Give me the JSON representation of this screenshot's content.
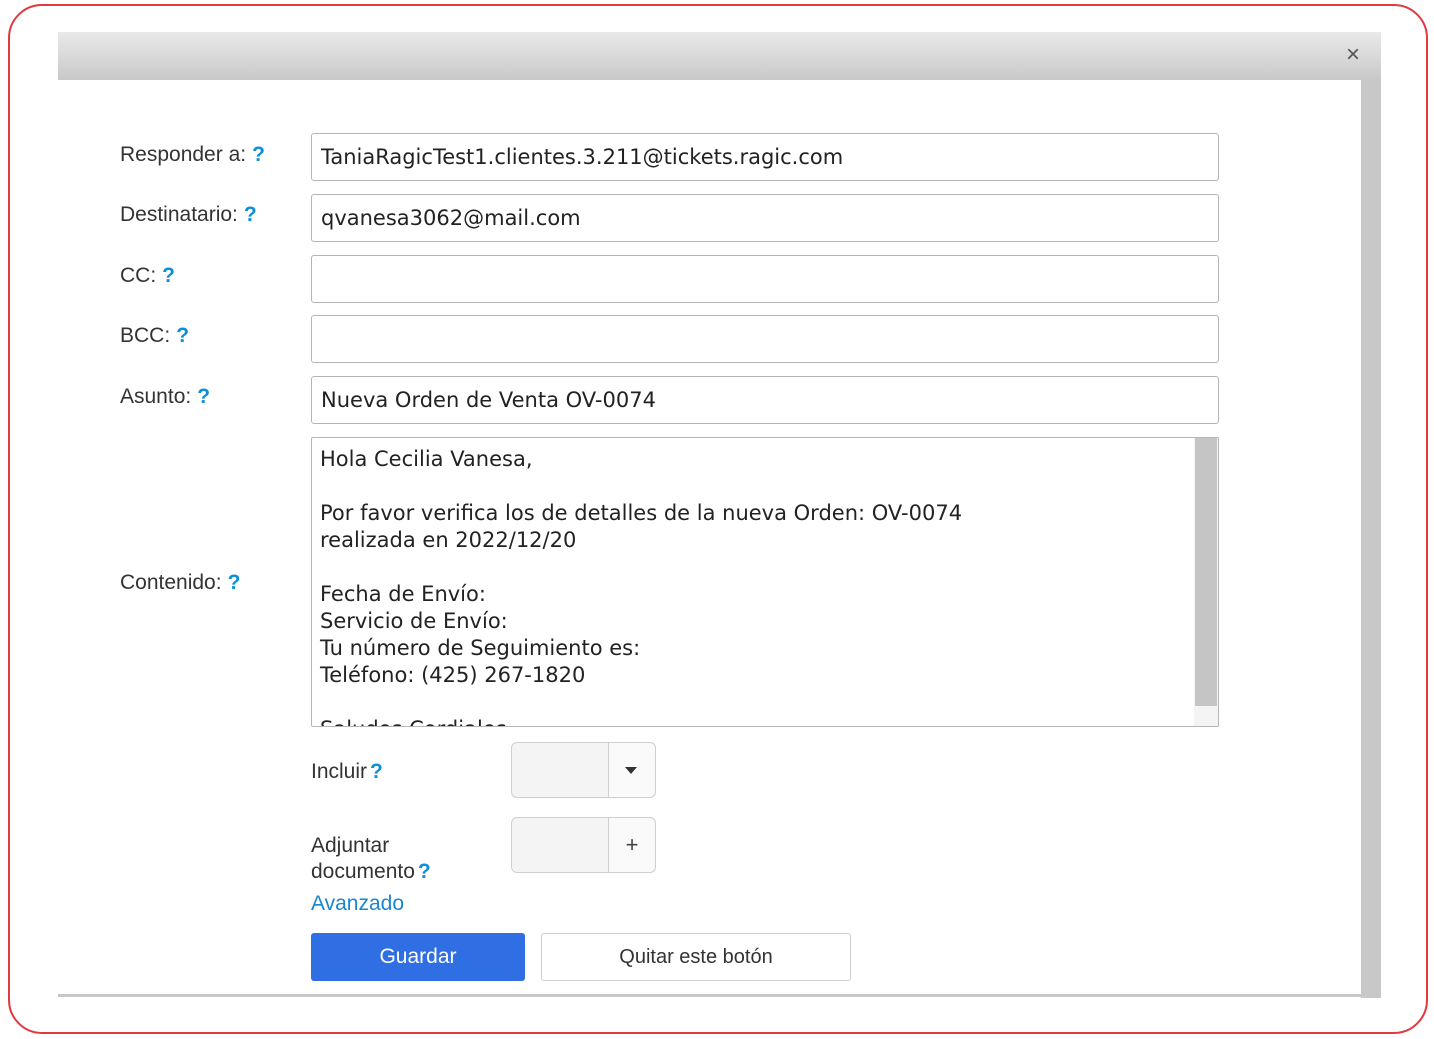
{
  "dialog": {
    "close_icon": "×"
  },
  "form": {
    "reply_to": {
      "label": "Responder a:",
      "help": "?",
      "value": "TaniaRagicTest1.clientes.3.211@tickets.ragic.com"
    },
    "recipient": {
      "label": "Destinatario:",
      "help": "?",
      "value": "qvanesa3062@mail.com"
    },
    "cc": {
      "label": "CC:",
      "help": "?",
      "value": ""
    },
    "bcc": {
      "label": "BCC:",
      "help": "?",
      "value": ""
    },
    "subject": {
      "label": "Asunto:",
      "help": "?",
      "value": "Nueva Orden de Venta OV-0074"
    },
    "content": {
      "label": "Contenido:",
      "help": "?",
      "value": "Hola Cecilia Vanesa,\n\nPor favor verifica los de detalles de la nueva Orden: OV-0074\nrealizada en 2022/12/20\n\nFecha de Envío:\nServicio de Envío:\nTu número de Seguimiento es:\nTeléfono: (425) 267-1820\n\nSaludos Cordiales"
    },
    "include": {
      "label": "Incluir",
      "help": "?",
      "button_icon": "chevron-down-icon"
    },
    "attach": {
      "label_line1": "Adjuntar",
      "label_line2": "documento",
      "help": "?",
      "button_symbol": "+"
    },
    "advanced_link": "Avanzado"
  },
  "buttons": {
    "save": "Guardar",
    "remove": "Quitar este botón"
  },
  "colors": {
    "frame_border": "#e0393e",
    "primary_button": "#2f6fe3",
    "help_icon": "#0b8fd9",
    "link": "#1a86d0"
  }
}
